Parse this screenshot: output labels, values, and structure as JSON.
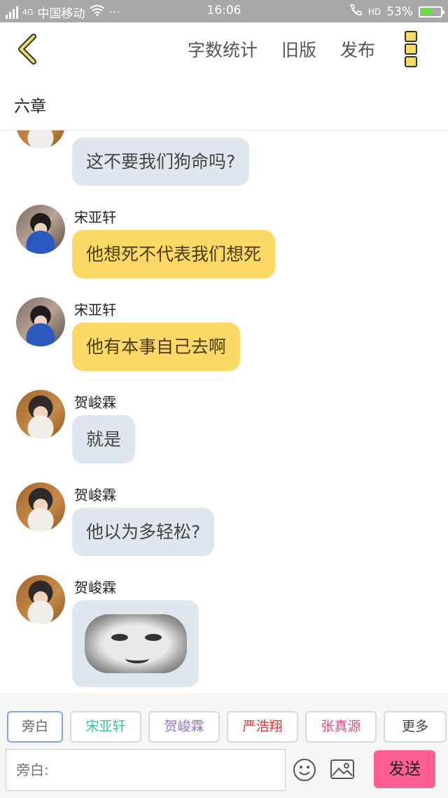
{
  "status_bar": {
    "network": "4G",
    "carrier": "中国移动",
    "more": "···",
    "time": "16:06",
    "hd": "HD",
    "battery": "53%",
    "battery_level": 0.53
  },
  "header": {
    "actions": [
      "字数统计",
      "旧版",
      "发布"
    ],
    "chapter_title": "六章"
  },
  "messages": [
    {
      "speaker": "",
      "avatar": "he",
      "text": "这不要我们狗命吗?",
      "style": "grey"
    },
    {
      "speaker": "宋亚轩",
      "avatar": "song",
      "text": "他想死不代表我们想死",
      "style": "yellow"
    },
    {
      "speaker": "宋亚轩",
      "avatar": "song",
      "text": "他有本事自己去啊",
      "style": "yellow"
    },
    {
      "speaker": "贺峻霖",
      "avatar": "he",
      "text": "就是",
      "style": "grey"
    },
    {
      "speaker": "贺峻霖",
      "avatar": "he",
      "text": "他以为多轻松?",
      "style": "grey"
    },
    {
      "speaker": "贺峻霖",
      "avatar": "he",
      "text": "",
      "style": "image"
    }
  ],
  "role_tabs": [
    {
      "label": "旁白",
      "color": "#666666",
      "active": true
    },
    {
      "label": "宋亚轩",
      "color": "#3dbfb0",
      "active": false
    },
    {
      "label": "贺峻霖",
      "color": "#9a6fd0",
      "active": false
    },
    {
      "label": "严浩翔",
      "color": "#e0302c",
      "active": false
    },
    {
      "label": "张真源",
      "color": "#e24a8c",
      "active": false
    },
    {
      "label": "更多",
      "color": "#444444",
      "active": false
    }
  ],
  "composer": {
    "placeholder": "旁白:",
    "send_label": "发送"
  },
  "colors": {
    "accent_yellow": "#fcd866",
    "bubble_grey": "#dfe6ee",
    "send_pink": "#ff5f95",
    "status_bar": "#a8a8a8"
  }
}
